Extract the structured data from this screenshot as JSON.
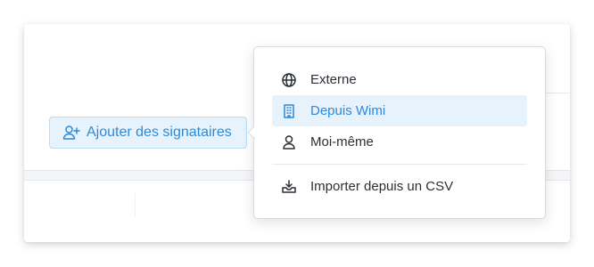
{
  "button": {
    "label": "Ajouter des signataires",
    "icon": "add-user-icon"
  },
  "menu": {
    "items": [
      {
        "label": "Externe",
        "icon": "globe-icon",
        "active": false
      },
      {
        "label": "Depuis Wimi",
        "icon": "building-icon",
        "active": true
      },
      {
        "label": "Moi-même",
        "icon": "user-icon",
        "active": false
      },
      {
        "label": "Importer depuis un CSV",
        "icon": "import-icon",
        "active": false
      }
    ]
  },
  "colors": {
    "accent": "#2e8ad6",
    "accent_bg": "#e6f2fc",
    "text": "#2b2f36"
  }
}
